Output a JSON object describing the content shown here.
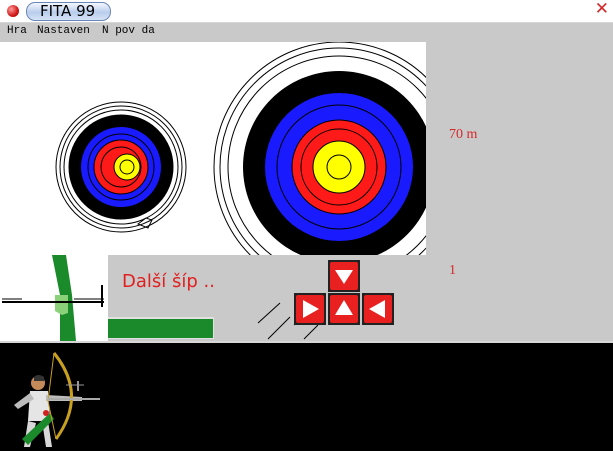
{
  "window": {
    "title": "FITA 99"
  },
  "menu": {
    "items": [
      "Hra",
      "Nastaven",
      "N pov da"
    ]
  },
  "status": {
    "distance": "70 m",
    "arrow_count": "1",
    "message": "Další šíp .."
  },
  "controls": {
    "down": "triangle-down-icon",
    "right": "triangle-right-icon",
    "up": "triangle-up-icon",
    "left": "triangle-left-icon"
  },
  "power": {
    "level": 0.99
  },
  "colors": {
    "accent": "#d42a2a",
    "target_white": "#ffffff",
    "target_black": "#000000",
    "target_blue": "#1a1aff",
    "target_red": "#ff1a1a",
    "target_gold": "#ffff00",
    "power_green": "#1a8a2a"
  }
}
